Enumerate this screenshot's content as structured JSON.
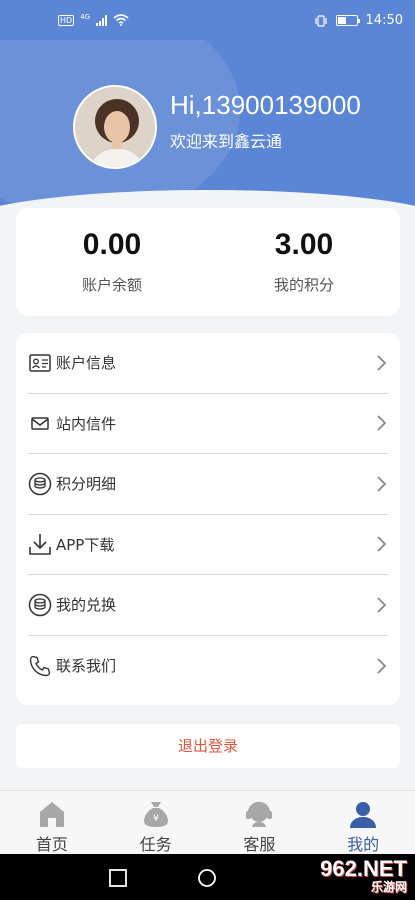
{
  "status_bar": {
    "time": "14:50",
    "network": "HD",
    "signal_type": "4G"
  },
  "profile": {
    "greeting": "Hi,13900139000",
    "welcome": "欢迎来到鑫云通"
  },
  "stats": [
    {
      "value": "0.00",
      "label": "账户余额"
    },
    {
      "value": "3.00",
      "label": "我的积分"
    }
  ],
  "menu": [
    {
      "label": "账户信息",
      "icon": "id-card-icon"
    },
    {
      "label": "站内信件",
      "icon": "mail-icon"
    },
    {
      "label": "积分明细",
      "icon": "coins-icon"
    },
    {
      "label": "APP下载",
      "icon": "download-icon"
    },
    {
      "label": "我的兑换",
      "icon": "coins-icon"
    },
    {
      "label": "联系我们",
      "icon": "phone-icon"
    }
  ],
  "logout_label": "退出登录",
  "tabs": [
    {
      "label": "首页",
      "icon": "home-icon"
    },
    {
      "label": "任务",
      "icon": "money-bag-icon"
    },
    {
      "label": "客服",
      "icon": "customer-service-icon"
    },
    {
      "label": "我的",
      "icon": "user-icon",
      "active": true
    }
  ],
  "watermark": {
    "main": "962.NET",
    "sub": "乐游网"
  },
  "colors": {
    "brand_blue": "#5b86d5",
    "active_tab": "#3b5fa6",
    "logout_red": "#e2573f"
  }
}
